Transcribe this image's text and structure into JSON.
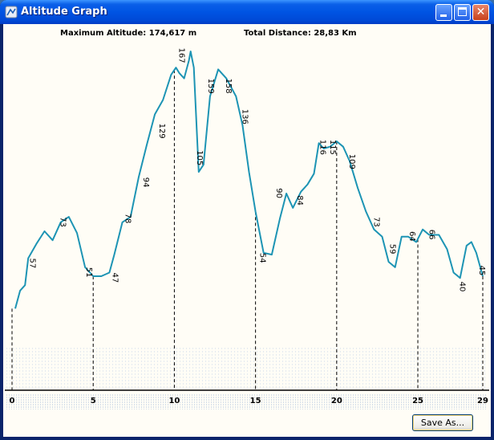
{
  "window": {
    "title": "Altitude Graph"
  },
  "header": {
    "max_altitude_label": "Maximum Altitude: 174,617 m",
    "total_distance_label": "Total Distance: 28,83 Km"
  },
  "buttons": {
    "save_as": "Save As..."
  },
  "colors": {
    "line": "#1d94b4",
    "axis": "#000000",
    "title_bar": "#0054e3",
    "close_button": "#d5532c"
  },
  "chart_data": {
    "type": "line",
    "xlabel": "",
    "ylabel": "",
    "xlim": [
      0,
      29
    ],
    "ylim": [
      0,
      175
    ],
    "x_ticks": [
      0,
      5,
      10,
      15,
      20,
      25,
      29
    ],
    "tick_dividers": [
      0,
      5,
      10,
      15,
      20,
      25,
      29
    ],
    "series": [
      {
        "points": [
          [
            0.2,
            32
          ],
          [
            0.5,
            42
          ],
          [
            0.8,
            45
          ],
          [
            1.0,
            60
          ],
          [
            1.5,
            68
          ],
          [
            2.0,
            75
          ],
          [
            2.5,
            70
          ],
          [
            3.0,
            80
          ],
          [
            3.5,
            83
          ],
          [
            4.0,
            74
          ],
          [
            4.5,
            55
          ],
          [
            5.0,
            50
          ],
          [
            5.5,
            50
          ],
          [
            6.0,
            52
          ],
          [
            6.3,
            62
          ],
          [
            6.8,
            80
          ],
          [
            7.3,
            83
          ],
          [
            7.8,
            105
          ],
          [
            8.3,
            123
          ],
          [
            8.8,
            140
          ],
          [
            9.3,
            148
          ],
          [
            9.8,
            162
          ],
          [
            10.1,
            166
          ],
          [
            10.3,
            163
          ],
          [
            10.6,
            160
          ],
          [
            10.9,
            170
          ],
          [
            11.0,
            175
          ],
          [
            11.2,
            166
          ],
          [
            11.5,
            108
          ],
          [
            11.8,
            112
          ],
          [
            12.2,
            150
          ],
          [
            12.7,
            165
          ],
          [
            13.2,
            160
          ],
          [
            13.8,
            150
          ],
          [
            14.2,
            134
          ],
          [
            14.6,
            108
          ],
          [
            15.0,
            86
          ],
          [
            15.5,
            63
          ],
          [
            16.0,
            62
          ],
          [
            16.5,
            82
          ],
          [
            16.9,
            96
          ],
          [
            17.3,
            88
          ],
          [
            17.8,
            97
          ],
          [
            18.2,
            101
          ],
          [
            18.6,
            107
          ],
          [
            18.9,
            124
          ],
          [
            19.2,
            121
          ],
          [
            19.6,
            122
          ],
          [
            20.0,
            125
          ],
          [
            20.4,
            122
          ],
          [
            20.8,
            114
          ],
          [
            21.3,
            99
          ],
          [
            21.8,
            86
          ],
          [
            22.3,
            76
          ],
          [
            22.8,
            72
          ],
          [
            23.2,
            58
          ],
          [
            23.6,
            55
          ],
          [
            24.0,
            72
          ],
          [
            24.4,
            72
          ],
          [
            24.9,
            69
          ],
          [
            25.3,
            76
          ],
          [
            25.7,
            73
          ],
          [
            26.3,
            73
          ],
          [
            26.8,
            65
          ],
          [
            27.2,
            52
          ],
          [
            27.6,
            49
          ],
          [
            28.0,
            67
          ],
          [
            28.3,
            69
          ],
          [
            28.6,
            63
          ],
          [
            29.0,
            50
          ]
        ]
      }
    ],
    "annotations": [
      {
        "x": 1.1,
        "y": 60,
        "label": "57"
      },
      {
        "x": 3.0,
        "y": 83,
        "label": "73"
      },
      {
        "x": 4.6,
        "y": 55,
        "label": "51"
      },
      {
        "x": 6.2,
        "y": 52,
        "label": "47"
      },
      {
        "x": 7.0,
        "y": 85,
        "label": "78"
      },
      {
        "x": 8.1,
        "y": 105,
        "label": "94"
      },
      {
        "x": 9.1,
        "y": 135,
        "label": "129"
      },
      {
        "x": 10.3,
        "y": 177,
        "label": "167"
      },
      {
        "x": 11.4,
        "y": 120,
        "label": "105"
      },
      {
        "x": 12.1,
        "y": 160,
        "label": "159"
      },
      {
        "x": 13.2,
        "y": 160,
        "label": "158"
      },
      {
        "x": 14.2,
        "y": 143,
        "label": "136"
      },
      {
        "x": 15.3,
        "y": 63,
        "label": "54"
      },
      {
        "x": 16.3,
        "y": 99,
        "label": "90"
      },
      {
        "x": 17.6,
        "y": 95,
        "label": "84"
      },
      {
        "x": 19.0,
        "y": 126,
        "label": "116"
      },
      {
        "x": 19.6,
        "y": 126,
        "label": "115"
      },
      {
        "x": 20.8,
        "y": 118,
        "label": "109"
      },
      {
        "x": 22.3,
        "y": 83,
        "label": "73"
      },
      {
        "x": 23.3,
        "y": 68,
        "label": "59"
      },
      {
        "x": 24.5,
        "y": 75,
        "label": "64"
      },
      {
        "x": 25.7,
        "y": 76,
        "label": "66"
      },
      {
        "x": 27.6,
        "y": 47,
        "label": "40"
      },
      {
        "x": 28.8,
        "y": 56,
        "label": "45"
      }
    ]
  }
}
